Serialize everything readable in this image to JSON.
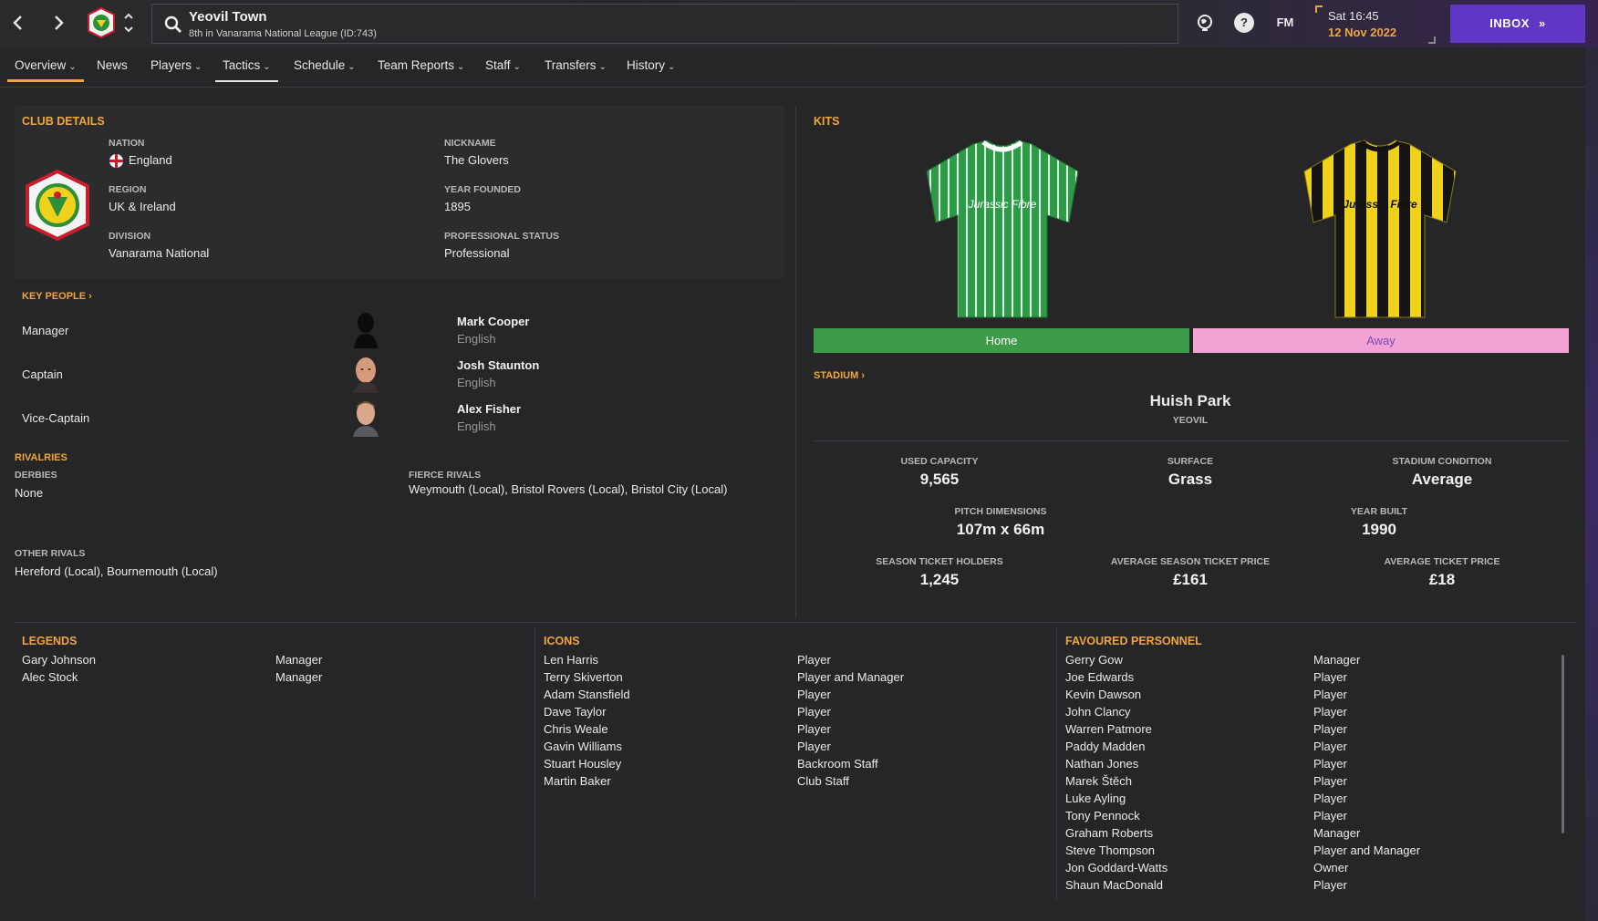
{
  "header": {
    "club_name": "Yeovil Town",
    "club_subtitle": "8th in Vanarama National League (ID:743)",
    "time": "Sat 16:45",
    "date": "12 Nov 2022",
    "fm_label": "FM",
    "help_label": "?",
    "inbox_label": "INBOX"
  },
  "tabs": [
    {
      "label": "Overview",
      "dropdown": true,
      "active": true
    },
    {
      "label": "News",
      "dropdown": false
    },
    {
      "label": "Players",
      "dropdown": true
    },
    {
      "label": "Tactics",
      "dropdown": true,
      "hover": true
    },
    {
      "label": "Schedule",
      "dropdown": true
    },
    {
      "label": "Team Reports",
      "dropdown": true
    },
    {
      "label": "Staff",
      "dropdown": true
    },
    {
      "label": "Transfers",
      "dropdown": true
    },
    {
      "label": "History",
      "dropdown": true
    }
  ],
  "club_details": {
    "title": "CLUB DETAILS",
    "nation_label": "NATION",
    "nation": "England",
    "region_label": "REGION",
    "region": "UK & Ireland",
    "division_label": "DIVISION",
    "division": "Vanarama National",
    "nickname_label": "NICKNAME",
    "nickname": "The Glovers",
    "founded_label": "YEAR FOUNDED",
    "founded": "1895",
    "status_label": "PROFESSIONAL STATUS",
    "status": "Professional"
  },
  "key_people": {
    "title": "KEY PEOPLE",
    "people": [
      {
        "role": "Manager",
        "name": "Mark Cooper",
        "nationality": "English"
      },
      {
        "role": "Captain",
        "name": "Josh Staunton",
        "nationality": "English"
      },
      {
        "role": "Vice-Captain",
        "name": "Alex Fisher",
        "nationality": "English"
      }
    ]
  },
  "rivalries": {
    "title": "RIVALRIES",
    "derbies_label": "DERBIES",
    "derbies": "None",
    "fierce_label": "FIERCE RIVALS",
    "fierce": "Weymouth (Local), Bristol Rovers (Local), Bristol City (Local)",
    "other_label": "OTHER RIVALS",
    "other": "Hereford (Local), Bournemouth (Local)"
  },
  "kits": {
    "title": "KITS",
    "home_label": "Home",
    "away_label": "Away",
    "sponsor": "Jurassic Fibre",
    "home_color": "#2a9d46",
    "away_color": "#f0d21a",
    "home_bar_color": "#3d9c4a",
    "away_bar_color": "#f2a3d6"
  },
  "stadium": {
    "title": "STADIUM",
    "name": "Huish Park",
    "town": "YEOVIL",
    "stats": [
      {
        "label": "USED CAPACITY",
        "value": "9,565"
      },
      {
        "label": "SURFACE",
        "value": "Grass"
      },
      {
        "label": "STADIUM CONDITION",
        "value": "Average"
      },
      {
        "label": "PITCH DIMENSIONS",
        "value": "107m x 66m"
      },
      {
        "label": "YEAR BUILT",
        "value": "1990"
      },
      {
        "label": "SEASON TICKET HOLDERS",
        "value": "1,245"
      },
      {
        "label": "AVERAGE SEASON TICKET PRICE",
        "value": "£161"
      },
      {
        "label": "AVERAGE TICKET PRICE",
        "value": "£18"
      }
    ]
  },
  "legends": {
    "title": "LEGENDS",
    "items": [
      {
        "name": "Gary Johnson",
        "role": "Manager"
      },
      {
        "name": "Alec Stock",
        "role": "Manager"
      }
    ]
  },
  "icons": {
    "title": "ICONS",
    "items": [
      {
        "name": "Len Harris",
        "role": "Player"
      },
      {
        "name": "Terry Skiverton",
        "role": "Player and Manager"
      },
      {
        "name": "Adam Stansfield",
        "role": "Player"
      },
      {
        "name": "Dave Taylor",
        "role": "Player"
      },
      {
        "name": "Chris Weale",
        "role": "Player"
      },
      {
        "name": "Gavin Williams",
        "role": "Player"
      },
      {
        "name": "Stuart Housley",
        "role": "Backroom Staff"
      },
      {
        "name": "Martin Baker",
        "role": "Club Staff"
      }
    ]
  },
  "favoured": {
    "title": "FAVOURED PERSONNEL",
    "items": [
      {
        "name": "Gerry Gow",
        "role": "Manager"
      },
      {
        "name": "Joe Edwards",
        "role": "Player"
      },
      {
        "name": "Kevin Dawson",
        "role": "Player"
      },
      {
        "name": "John Clancy",
        "role": "Player"
      },
      {
        "name": "Warren Patmore",
        "role": "Player"
      },
      {
        "name": "Paddy Madden",
        "role": "Player"
      },
      {
        "name": "Nathan Jones",
        "role": "Player"
      },
      {
        "name": "Marek Štěch",
        "role": "Player"
      },
      {
        "name": "Luke Ayling",
        "role": "Player"
      },
      {
        "name": "Tony Pennock",
        "role": "Player"
      },
      {
        "name": "Graham Roberts",
        "role": "Manager"
      },
      {
        "name": "Steve Thompson",
        "role": "Player and Manager"
      },
      {
        "name": "Jon Goddard-Watts",
        "role": "Owner"
      },
      {
        "name": "Shaun MacDonald",
        "role": "Player"
      }
    ]
  },
  "colors": {
    "accent": "#f0a53a",
    "inbox": "#5f37c4",
    "background": "#262628"
  }
}
